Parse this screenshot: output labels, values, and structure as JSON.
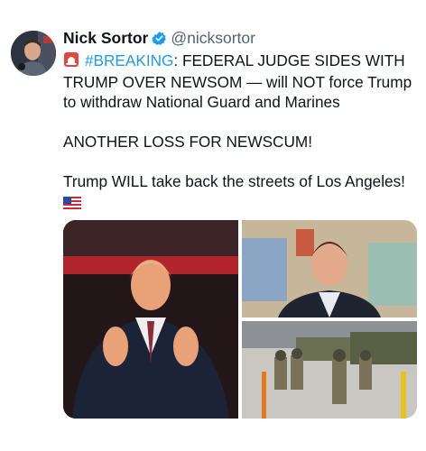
{
  "tweet": {
    "author_name": "Nick Sortor",
    "author_handle": "@nicksortor",
    "avatar_icon": "user-avatar-photo",
    "verified_icon": "verified-badge-icon",
    "text": {
      "hashtag": "#BREAKING",
      "line1_rest": ": FEDERAL JUDGE SIDES WITH TRUMP OVER NEWSOM — will NOT force Trump to withdraw National Guard and Marines",
      "paragraph2": "ANOTHER LOSS FOR NEWSCUM!",
      "paragraph3": "Trump WILL take back the streets of Los Angeles!"
    },
    "emoji": {
      "siren": "siren-icon",
      "flag": "us-flag-icon"
    },
    "media": {
      "count": 3,
      "items": [
        "photo-trump-clapping",
        "photo-newsom",
        "photo-national-guard"
      ]
    }
  }
}
